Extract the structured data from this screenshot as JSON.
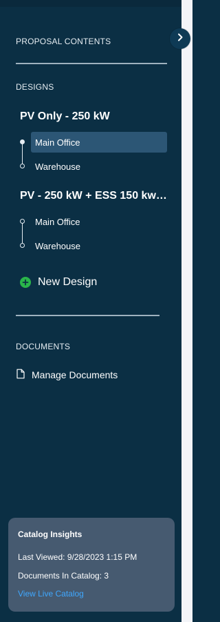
{
  "sidebar": {
    "proposal_contents_label": "PROPOSAL CONTENTS",
    "designs_label": "DESIGNS",
    "designs": [
      {
        "title": "PV Only - 250 kW",
        "sites": [
          {
            "label": "Main Office",
            "selected": true
          },
          {
            "label": "Warehouse",
            "selected": false
          }
        ]
      },
      {
        "title": "PV - 250 kW + ESS 150 kw |...",
        "sites": [
          {
            "label": "Main Office",
            "selected": false
          },
          {
            "label": "Warehouse",
            "selected": false
          }
        ]
      }
    ],
    "new_design_label": "New Design",
    "documents_label": "DOCUMENTS",
    "manage_documents_label": "Manage Documents"
  },
  "catalog_insights": {
    "title": "Catalog Insights",
    "last_viewed": "Last Viewed: 9/28/2023 1:15 PM",
    "documents_in_catalog": "Documents In Catalog: 3",
    "view_live_catalog": "View Live Catalog"
  },
  "icons": {
    "collapse": "chevron-right-icon",
    "new_design": "plus-circle-icon",
    "documents": "document-icon"
  },
  "colors": {
    "panel_bg": "#0b2f44",
    "selected_item_bg": "#2c5675",
    "accent_green": "#2ab54a",
    "link_blue": "#3fa8ff",
    "insights_bg": "#465a70"
  }
}
